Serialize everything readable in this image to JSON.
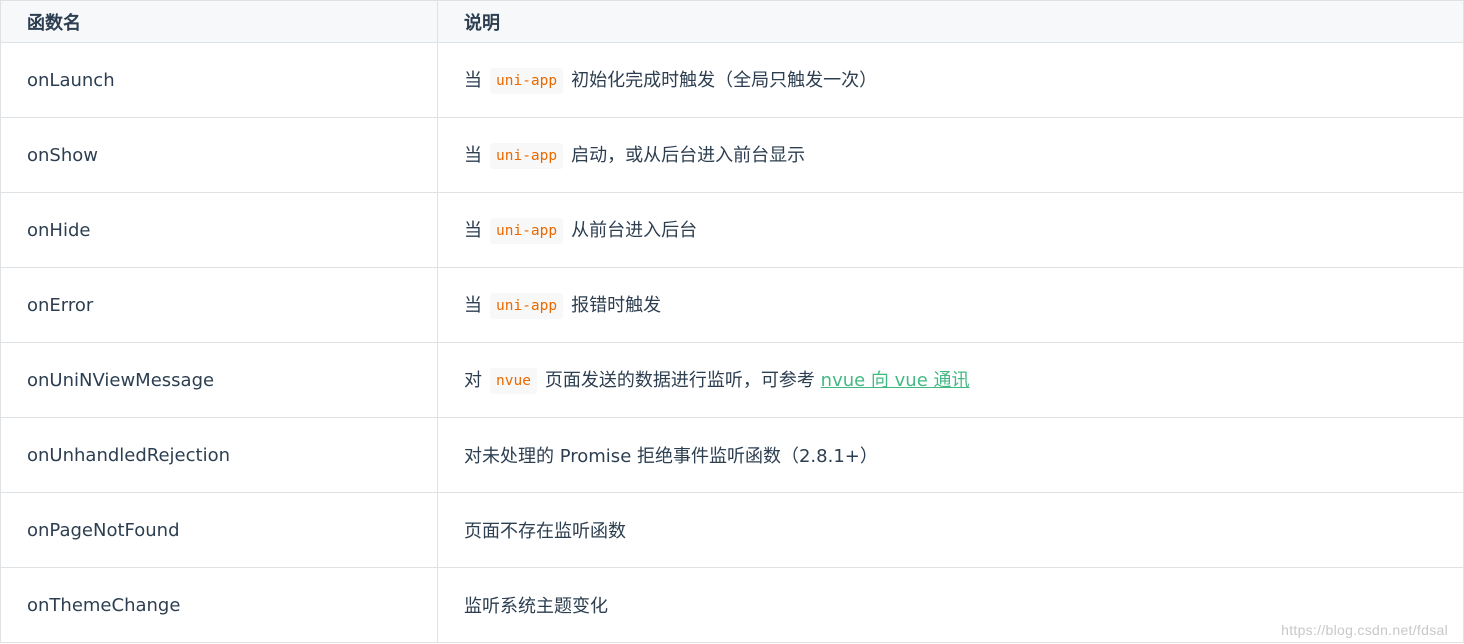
{
  "table": {
    "headers": [
      "函数名",
      "说明"
    ],
    "rows": [
      {
        "name": "onLaunch",
        "pre": "当",
        "code": "uni-app",
        "post": "初始化完成时触发（全局只触发一次）"
      },
      {
        "name": "onShow",
        "pre": "当",
        "code": "uni-app",
        "post": "启动，或从后台进入前台显示"
      },
      {
        "name": "onHide",
        "pre": "当",
        "code": "uni-app",
        "post": "从前台进入后台"
      },
      {
        "name": "onError",
        "pre": "当",
        "code": "uni-app",
        "post": "报错时触发"
      },
      {
        "name": "onUniNViewMessage",
        "pre": "对",
        "code": "nvue",
        "post": "页面发送的数据进行监听，可参考",
        "link": "nvue 向 vue 通讯"
      },
      {
        "name": "onUnhandledRejection",
        "desc": "对未处理的 Promise 拒绝事件监听函数（2.8.1+）"
      },
      {
        "name": "onPageNotFound",
        "desc": "页面不存在监听函数"
      },
      {
        "name": "onThemeChange",
        "desc": "监听系统主题变化"
      }
    ]
  },
  "watermark": "https://blog.csdn.net/fdsal",
  "colors": {
    "text": "#2c3e50",
    "code_text": "#e96900",
    "code_bg": "#f8f8f8",
    "link": "#42b983",
    "border": "#dfe2e5",
    "header_bg": "#f6f8fa"
  }
}
